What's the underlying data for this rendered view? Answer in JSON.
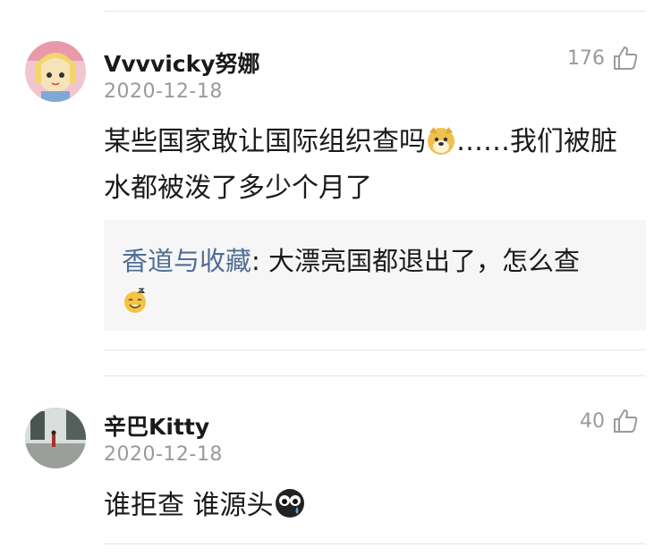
{
  "comments": [
    {
      "username": "Vvvvicky努娜",
      "date": "2020-12-18",
      "likes": "176",
      "content_part1": "某些国家敢让国际组织查吗",
      "content_emoji_1": "doge-emoji",
      "content_part2": "……我们被脏水都被泼了多少个月了",
      "reply": {
        "author": "香道与收藏",
        "separator": ": ",
        "text": "大漂亮国都退出了，怎么查",
        "emoji": "sweat-smile-emoji"
      }
    },
    {
      "username": "辛巴Kitty",
      "date": "2020-12-18",
      "likes": "40",
      "content_part1": "谁拒查 谁源头",
      "content_emoji_1": "crying-eyes-emoji"
    }
  ],
  "icons": {
    "like": "thumbs-up-icon"
  },
  "colors": {
    "reply_author": "#506d96",
    "meta": "#9a9a9a",
    "reply_bg": "#f6f6f6"
  }
}
